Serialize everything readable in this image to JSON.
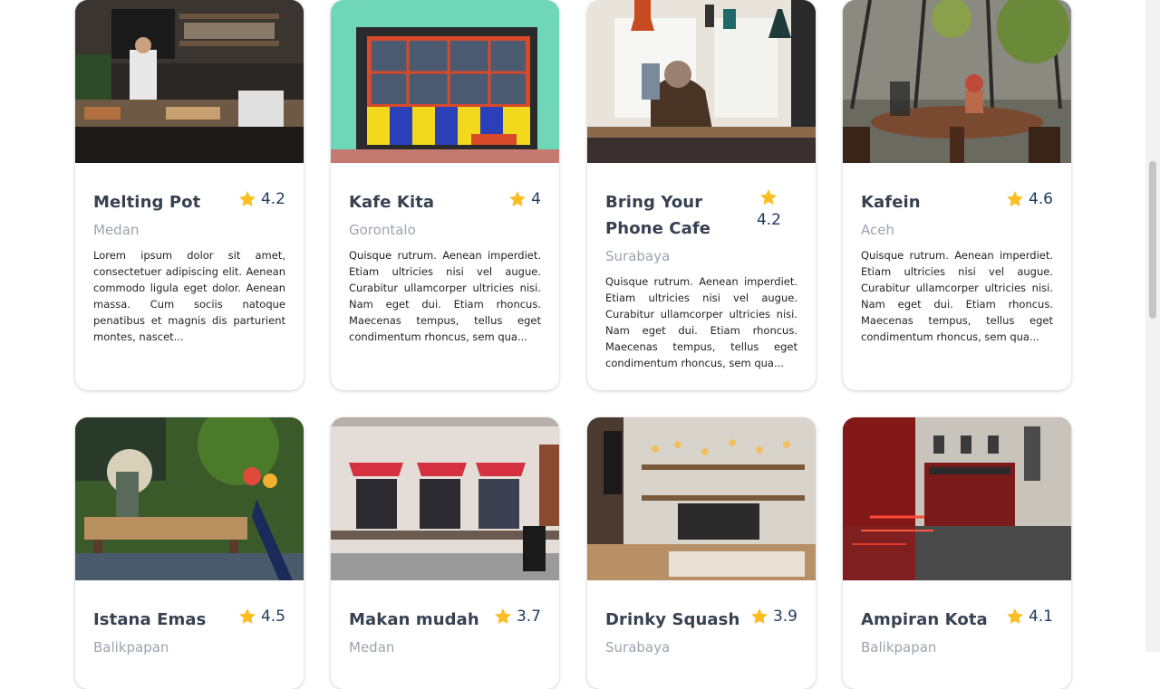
{
  "cafes": [
    {
      "name": "Melting Pot",
      "rating": "4.2",
      "city": "Medan",
      "desc": "Lorem ipsum dolor sit amet, consectetuer adipiscing elit. Aenean commodo ligula eget dolor. Aenean massa. Cum sociis natoque penatibus et magnis dis parturient montes, nascet..."
    },
    {
      "name": "Kafe Kita",
      "rating": "4",
      "city": "Gorontalo",
      "desc": "Quisque rutrum. Aenean imperdiet. Etiam ultricies nisi vel augue. Curabitur ullamcorper ultricies nisi. Nam eget dui. Etiam rhoncus. Maecenas tempus, tellus eget condimentum rhoncus, sem qua..."
    },
    {
      "name": "Bring Your Phone Cafe",
      "rating": "4.2",
      "city": "Surabaya",
      "desc": "Quisque rutrum. Aenean imperdiet. Etiam ultricies nisi vel augue. Curabitur ullamcorper ultricies nisi. Nam eget dui. Etiam rhoncus. Maecenas tempus, tellus eget condimentum rhoncus, sem qua..."
    },
    {
      "name": "Kafein",
      "rating": "4.6",
      "city": "Aceh",
      "desc": "Quisque rutrum. Aenean imperdiet. Etiam ultricies nisi vel augue. Curabitur ullamcorper ultricies nisi. Nam eget dui. Etiam rhoncus. Maecenas tempus, tellus eget condimentum rhoncus, sem qua..."
    },
    {
      "name": "Istana Emas",
      "rating": "4.5",
      "city": "Balikpapan",
      "desc": ""
    },
    {
      "name": "Makan mudah",
      "rating": "3.7",
      "city": "Medan",
      "desc": ""
    },
    {
      "name": "Drinky Squash",
      "rating": "3.9",
      "city": "Surabaya",
      "desc": ""
    },
    {
      "name": "Ampiran Kota",
      "rating": "4.1",
      "city": "Balikpapan",
      "desc": ""
    }
  ],
  "icons": {
    "rating": "star-icon"
  },
  "colors": {
    "star": "#fbbf24",
    "rating_text": "#1e3a5f",
    "city": "#9ca3af"
  }
}
